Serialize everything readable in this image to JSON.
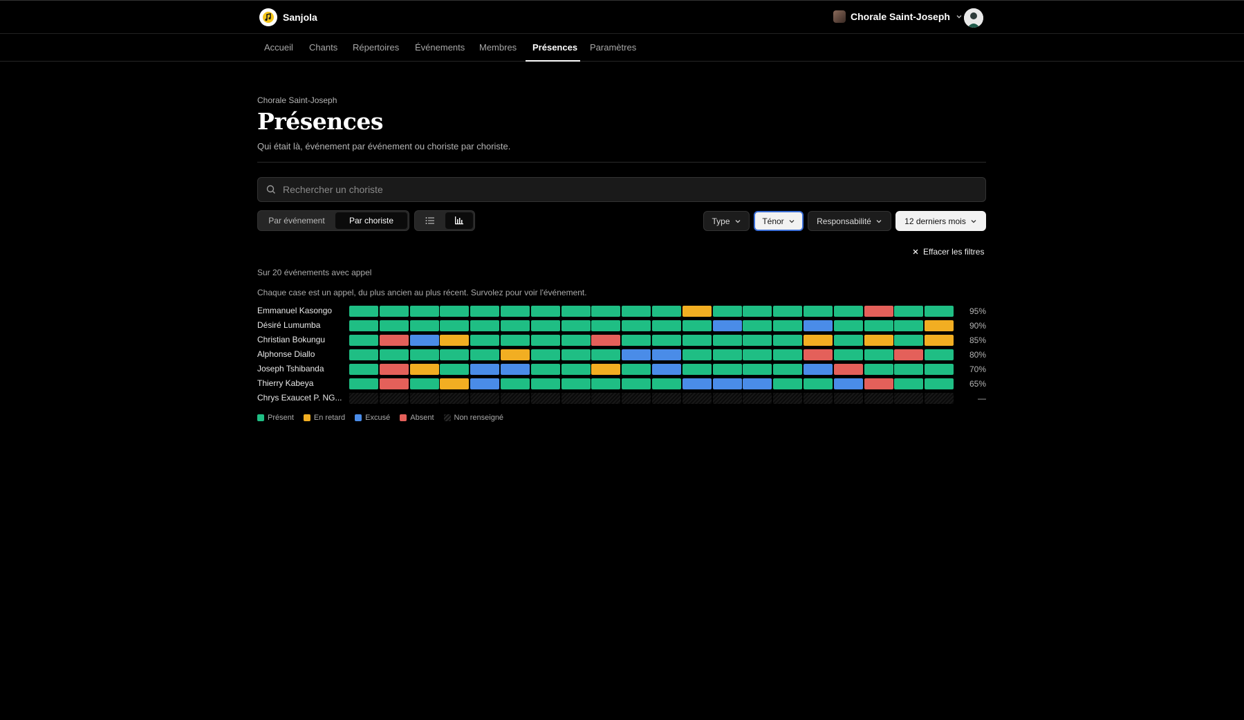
{
  "header": {
    "app_name": "Sanjola",
    "organization": "Chorale Saint-Joseph"
  },
  "nav": {
    "items": [
      "Accueil",
      "Chants",
      "Répertoires",
      "Événements",
      "Membres",
      "Présences",
      "Paramètres"
    ],
    "active": "Présences"
  },
  "page": {
    "breadcrumb": "Chorale Saint-Joseph",
    "title": "Présences",
    "subtitle": "Qui était là, événement par événement ou choriste par choriste."
  },
  "search": {
    "placeholder": "Rechercher un choriste",
    "value": ""
  },
  "mode_toggle": {
    "by_event": "Par événement",
    "by_member": "Par choriste",
    "active": "Par choriste"
  },
  "view_toggle": {
    "list_icon": "list-icon",
    "chart_icon": "bar-chart-icon",
    "active": "chart"
  },
  "filters": {
    "type": "Type",
    "voice": "Ténor",
    "role": "Responsabilité",
    "period": "12 derniers mois",
    "clear": "Effacer les filtres"
  },
  "summary": "Sur 20 événements avec appel",
  "hint": "Chaque case est un appel, du plus ancien au plus récent. Survolez pour voir l'événement.",
  "status_colors": {
    "present": "#1fbe84",
    "late": "#f2ae22",
    "excused": "#4a8ce8",
    "absent": "#e4605a"
  },
  "rows": [
    {
      "name": "Emmanuel Kasongo",
      "pct": "95%",
      "cells": [
        "present",
        "present",
        "present",
        "present",
        "present",
        "present",
        "present",
        "present",
        "present",
        "present",
        "present",
        "late",
        "present",
        "present",
        "present",
        "present",
        "present",
        "absent",
        "present",
        "present"
      ]
    },
    {
      "name": "Désiré Lumumba",
      "pct": "90%",
      "cells": [
        "present",
        "present",
        "present",
        "present",
        "present",
        "present",
        "present",
        "present",
        "present",
        "present",
        "present",
        "present",
        "excused",
        "present",
        "present",
        "excused",
        "present",
        "present",
        "present",
        "late"
      ]
    },
    {
      "name": "Christian Bokungu",
      "pct": "85%",
      "cells": [
        "present",
        "absent",
        "excused",
        "late",
        "present",
        "present",
        "present",
        "present",
        "absent",
        "present",
        "present",
        "present",
        "present",
        "present",
        "present",
        "late",
        "present",
        "late",
        "present",
        "late"
      ]
    },
    {
      "name": "Alphonse Diallo",
      "pct": "80%",
      "cells": [
        "present",
        "present",
        "present",
        "present",
        "present",
        "late",
        "present",
        "present",
        "present",
        "excused",
        "excused",
        "present",
        "present",
        "present",
        "present",
        "absent",
        "present",
        "present",
        "absent",
        "present"
      ]
    },
    {
      "name": "Joseph Tshibanda",
      "pct": "70%",
      "cells": [
        "present",
        "absent",
        "late",
        "present",
        "excused",
        "excused",
        "present",
        "present",
        "late",
        "present",
        "excused",
        "present",
        "present",
        "present",
        "present",
        "excused",
        "absent",
        "present",
        "present",
        "present"
      ]
    },
    {
      "name": "Thierry Kabeya",
      "pct": "65%",
      "cells": [
        "present",
        "absent",
        "present",
        "late",
        "excused",
        "present",
        "present",
        "present",
        "present",
        "present",
        "present",
        "excused",
        "excused",
        "excused",
        "present",
        "present",
        "excused",
        "absent",
        "present",
        "present"
      ]
    },
    {
      "name": "Chrys Exaucet P. NG...",
      "pct": "—",
      "cells": [
        "none",
        "none",
        "none",
        "none",
        "none",
        "none",
        "none",
        "none",
        "none",
        "none",
        "none",
        "none",
        "none",
        "none",
        "none",
        "none",
        "none",
        "none",
        "none",
        "none"
      ]
    }
  ],
  "legend": {
    "present": "Présent",
    "late": "En retard",
    "excused": "Excusé",
    "absent": "Absent",
    "none": "Non renseigné"
  }
}
